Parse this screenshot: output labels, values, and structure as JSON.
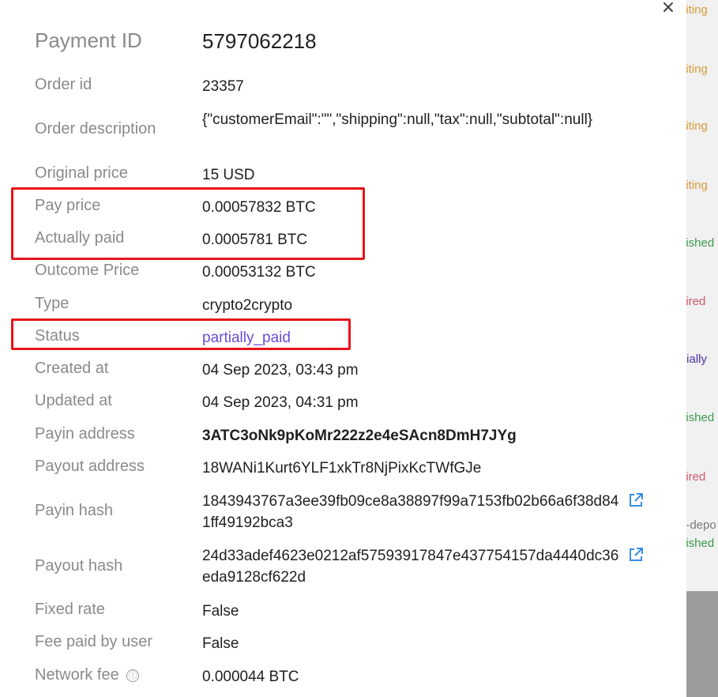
{
  "background": {
    "statuses": [
      {
        "text": "aiting",
        "color": "#d79a3a"
      },
      {
        "text": "aiting",
        "color": "#d79a3a"
      },
      {
        "text": "aiting",
        "color": "#d79a3a"
      },
      {
        "text": "aiting",
        "color": "#d79a3a"
      },
      {
        "text": "nished",
        "color": "#3b9b4a"
      },
      {
        "text": "pired",
        "color": "#d0586a"
      },
      {
        "text": "rtially",
        "color": "#4b2fa8"
      },
      {
        "text": "nished",
        "color": "#3b9b4a"
      },
      {
        "text": "pired",
        "color": "#d0586a"
      },
      {
        "text": "nished",
        "color": "#3b9b4a"
      }
    ],
    "subtext": "e-depo"
  },
  "modal": {
    "close_icon": "×",
    "title_label": "Payment ID",
    "title_value": "5797062218",
    "fields": {
      "order_id": {
        "label": "Order id",
        "value": "23357"
      },
      "order_description": {
        "label": "Order description",
        "value": "{\"customerEmail\":\"\",\"shipping\":null,\"tax\":null,\"subtotal\":null}"
      },
      "original_price": {
        "label": "Original price",
        "value": "15 USD"
      },
      "pay_price": {
        "label": "Pay price",
        "value": "0.00057832 BTC"
      },
      "actually_paid": {
        "label": "Actually paid",
        "value": "0.0005781 BTC"
      },
      "outcome_price": {
        "label": "Outcome Price",
        "value": "0.00053132 BTC"
      },
      "type": {
        "label": "Type",
        "value": "crypto2crypto"
      },
      "status": {
        "label": "Status",
        "value": "partially_paid"
      },
      "created_at": {
        "label": "Created at",
        "value": "04 Sep 2023, 03:43 pm"
      },
      "updated_at": {
        "label": "Updated at",
        "value": "04 Sep 2023, 04:31 pm"
      },
      "payin_address": {
        "label": "Payin address",
        "value": "3ATC3oNk9pKoMr222z2e4eSAcn8DmH7JYg"
      },
      "payout_address": {
        "label": "Payout address",
        "value": "18WANi1Kurt6YLF1xkTr8NjPixKcTWfGJe"
      },
      "payin_hash": {
        "label": "Payin hash",
        "value": "1843943767a3ee39fb09ce8a38897f99a7153fb02b66a6f38d841ff49192bca3"
      },
      "payout_hash": {
        "label": "Payout hash",
        "value": "24d33adef4623e0212af57593917847e437754157da4440dc36eda9128cf622d"
      },
      "fixed_rate": {
        "label": "Fixed rate",
        "value": "False"
      },
      "fee_paid_by_user": {
        "label": "Fee paid by user",
        "value": "False"
      },
      "network_fee": {
        "label": "Network fee",
        "value": "0.000044 BTC",
        "info_icon": "ⓘ"
      }
    }
  },
  "colors": {
    "highlight": "#e8141a",
    "status_link": "#6b4bd6",
    "external_link_icon": "#3a8ee6"
  }
}
